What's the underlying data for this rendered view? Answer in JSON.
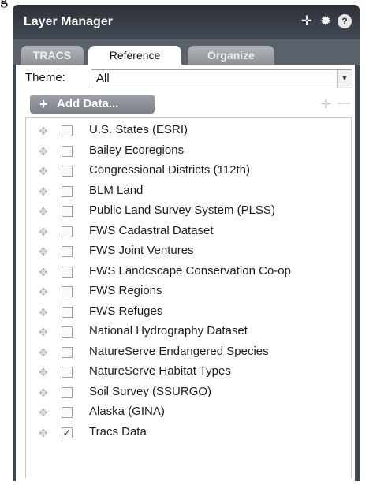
{
  "caption": "g",
  "panel": {
    "title": "Layer Manager",
    "icons": [
      "move-icon",
      "gear-icon",
      "help-icon"
    ]
  },
  "tabs": [
    {
      "label": "TRACS",
      "active": false
    },
    {
      "label": "Reference",
      "active": true
    },
    {
      "label": "Organize",
      "active": false
    }
  ],
  "theme": {
    "label": "Theme:",
    "value": "All"
  },
  "add_data_label": "Add Data...",
  "layers": [
    {
      "name": "U.S. States (ESRI)",
      "checked": false
    },
    {
      "name": "Bailey Ecoregions",
      "checked": false
    },
    {
      "name": "Congressional Districts (112th)",
      "checked": false
    },
    {
      "name": "BLM Land",
      "checked": false
    },
    {
      "name": "Public Land Survey System (PLSS)",
      "checked": false
    },
    {
      "name": "FWS Cadastral Dataset",
      "checked": false
    },
    {
      "name": "FWS Joint Ventures",
      "checked": false
    },
    {
      "name": "FWS Landcscape Conservation Co-op",
      "checked": false
    },
    {
      "name": "FWS Regions",
      "checked": false
    },
    {
      "name": "FWS Refuges",
      "checked": false
    },
    {
      "name": "National Hydrography Dataset",
      "checked": false
    },
    {
      "name": "NatureServe Endangered Species",
      "checked": false
    },
    {
      "name": "NatureServe Habitat Types",
      "checked": false
    },
    {
      "name": "Soil Survey (SSURGO)",
      "checked": false
    },
    {
      "name": "Alaska (GINA)",
      "checked": false
    },
    {
      "name": "Tracs Data",
      "checked": true
    }
  ]
}
